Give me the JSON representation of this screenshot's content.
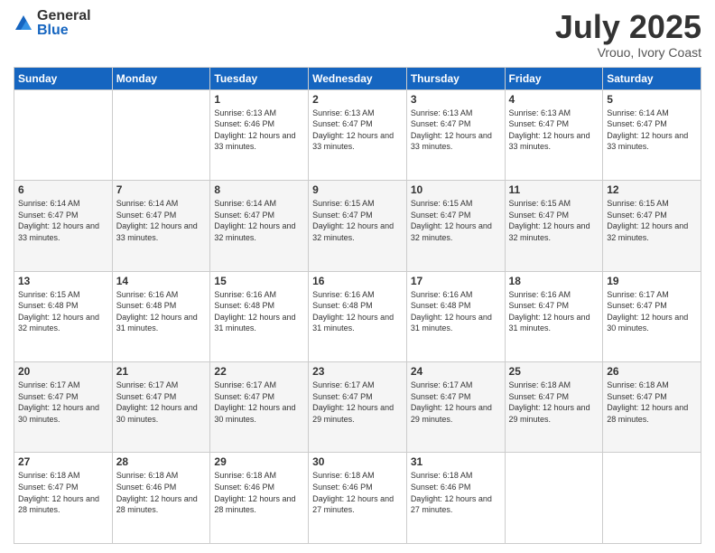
{
  "logo": {
    "general": "General",
    "blue": "Blue"
  },
  "title": {
    "month": "July 2025",
    "location": "Vrouo, Ivory Coast"
  },
  "days_of_week": [
    "Sunday",
    "Monday",
    "Tuesday",
    "Wednesday",
    "Thursday",
    "Friday",
    "Saturday"
  ],
  "weeks": [
    [
      {
        "day": "",
        "info": ""
      },
      {
        "day": "",
        "info": ""
      },
      {
        "day": "1",
        "info": "Sunrise: 6:13 AM\nSunset: 6:46 PM\nDaylight: 12 hours and 33 minutes."
      },
      {
        "day": "2",
        "info": "Sunrise: 6:13 AM\nSunset: 6:47 PM\nDaylight: 12 hours and 33 minutes."
      },
      {
        "day": "3",
        "info": "Sunrise: 6:13 AM\nSunset: 6:47 PM\nDaylight: 12 hours and 33 minutes."
      },
      {
        "day": "4",
        "info": "Sunrise: 6:13 AM\nSunset: 6:47 PM\nDaylight: 12 hours and 33 minutes."
      },
      {
        "day": "5",
        "info": "Sunrise: 6:14 AM\nSunset: 6:47 PM\nDaylight: 12 hours and 33 minutes."
      }
    ],
    [
      {
        "day": "6",
        "info": "Sunrise: 6:14 AM\nSunset: 6:47 PM\nDaylight: 12 hours and 33 minutes."
      },
      {
        "day": "7",
        "info": "Sunrise: 6:14 AM\nSunset: 6:47 PM\nDaylight: 12 hours and 33 minutes."
      },
      {
        "day": "8",
        "info": "Sunrise: 6:14 AM\nSunset: 6:47 PM\nDaylight: 12 hours and 32 minutes."
      },
      {
        "day": "9",
        "info": "Sunrise: 6:15 AM\nSunset: 6:47 PM\nDaylight: 12 hours and 32 minutes."
      },
      {
        "day": "10",
        "info": "Sunrise: 6:15 AM\nSunset: 6:47 PM\nDaylight: 12 hours and 32 minutes."
      },
      {
        "day": "11",
        "info": "Sunrise: 6:15 AM\nSunset: 6:47 PM\nDaylight: 12 hours and 32 minutes."
      },
      {
        "day": "12",
        "info": "Sunrise: 6:15 AM\nSunset: 6:47 PM\nDaylight: 12 hours and 32 minutes."
      }
    ],
    [
      {
        "day": "13",
        "info": "Sunrise: 6:15 AM\nSunset: 6:48 PM\nDaylight: 12 hours and 32 minutes."
      },
      {
        "day": "14",
        "info": "Sunrise: 6:16 AM\nSunset: 6:48 PM\nDaylight: 12 hours and 31 minutes."
      },
      {
        "day": "15",
        "info": "Sunrise: 6:16 AM\nSunset: 6:48 PM\nDaylight: 12 hours and 31 minutes."
      },
      {
        "day": "16",
        "info": "Sunrise: 6:16 AM\nSunset: 6:48 PM\nDaylight: 12 hours and 31 minutes."
      },
      {
        "day": "17",
        "info": "Sunrise: 6:16 AM\nSunset: 6:48 PM\nDaylight: 12 hours and 31 minutes."
      },
      {
        "day": "18",
        "info": "Sunrise: 6:16 AM\nSunset: 6:47 PM\nDaylight: 12 hours and 31 minutes."
      },
      {
        "day": "19",
        "info": "Sunrise: 6:17 AM\nSunset: 6:47 PM\nDaylight: 12 hours and 30 minutes."
      }
    ],
    [
      {
        "day": "20",
        "info": "Sunrise: 6:17 AM\nSunset: 6:47 PM\nDaylight: 12 hours and 30 minutes."
      },
      {
        "day": "21",
        "info": "Sunrise: 6:17 AM\nSunset: 6:47 PM\nDaylight: 12 hours and 30 minutes."
      },
      {
        "day": "22",
        "info": "Sunrise: 6:17 AM\nSunset: 6:47 PM\nDaylight: 12 hours and 30 minutes."
      },
      {
        "day": "23",
        "info": "Sunrise: 6:17 AM\nSunset: 6:47 PM\nDaylight: 12 hours and 29 minutes."
      },
      {
        "day": "24",
        "info": "Sunrise: 6:17 AM\nSunset: 6:47 PM\nDaylight: 12 hours and 29 minutes."
      },
      {
        "day": "25",
        "info": "Sunrise: 6:18 AM\nSunset: 6:47 PM\nDaylight: 12 hours and 29 minutes."
      },
      {
        "day": "26",
        "info": "Sunrise: 6:18 AM\nSunset: 6:47 PM\nDaylight: 12 hours and 28 minutes."
      }
    ],
    [
      {
        "day": "27",
        "info": "Sunrise: 6:18 AM\nSunset: 6:47 PM\nDaylight: 12 hours and 28 minutes."
      },
      {
        "day": "28",
        "info": "Sunrise: 6:18 AM\nSunset: 6:46 PM\nDaylight: 12 hours and 28 minutes."
      },
      {
        "day": "29",
        "info": "Sunrise: 6:18 AM\nSunset: 6:46 PM\nDaylight: 12 hours and 28 minutes."
      },
      {
        "day": "30",
        "info": "Sunrise: 6:18 AM\nSunset: 6:46 PM\nDaylight: 12 hours and 27 minutes."
      },
      {
        "day": "31",
        "info": "Sunrise: 6:18 AM\nSunset: 6:46 PM\nDaylight: 12 hours and 27 minutes."
      },
      {
        "day": "",
        "info": ""
      },
      {
        "day": "",
        "info": ""
      }
    ]
  ]
}
